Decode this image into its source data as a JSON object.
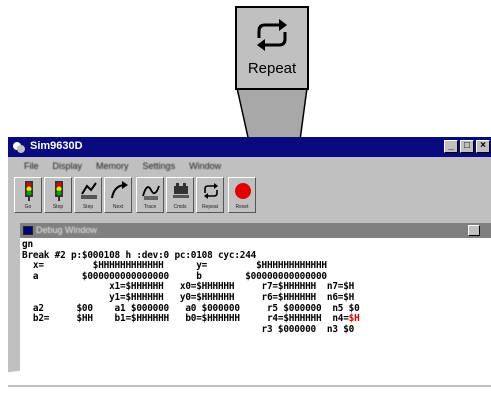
{
  "callout": {
    "label": "Repeat"
  },
  "window": {
    "title": "Sim9630D"
  },
  "menu": [
    "File",
    "Display",
    "Memory",
    "Settings",
    "Window"
  ],
  "toolbar": [
    {
      "label": "Go",
      "icon": "traffic-light-icon"
    },
    {
      "label": "Stop",
      "icon": "traffic-light-icon"
    },
    {
      "label": "Step",
      "icon": "step-icon"
    },
    {
      "label": "Next",
      "icon": "next-arrow-icon"
    },
    {
      "label": "Trace",
      "icon": "trace-icon"
    },
    {
      "label": "Cmds",
      "icon": "cmds-icon"
    },
    {
      "label": "Repeat",
      "icon": "repeat-icon"
    },
    {
      "label": "Reset",
      "icon": "reset-icon"
    }
  ],
  "child": {
    "title": "Debug Window"
  },
  "console": {
    "line1": "gn",
    "line2": "Break #2 p:$000108 h :dev:0 pc:0108 cyc:244",
    "rows": [
      {
        "text": "  x=         $HHHHHHHHHHHH      y=         $HHHHHHHHHHHH"
      },
      {
        "text": "  a        $000000000000000     b        $00000000000000"
      },
      {
        "text": "                x1=$HHHHHH   x0=$HHHHHH     r7=$HHHHHH  n7=$H"
      },
      {
        "text": "                y1=$HHHHHH   y0=$HHHHHH     r6=$HHHHHH  n6=$H"
      },
      {
        "text": "  a2      $00    a1 $000000   a0 $000000     r5 $000000  n5 $0"
      },
      {
        "text": "  b2=     $HH    b1=$HHHHHH   b0=$HHHHHH     r4=$HHHHHH  n4=",
        "red": "$H"
      },
      {
        "text": "                                            r3 $000000  n3 $0"
      }
    ]
  }
}
